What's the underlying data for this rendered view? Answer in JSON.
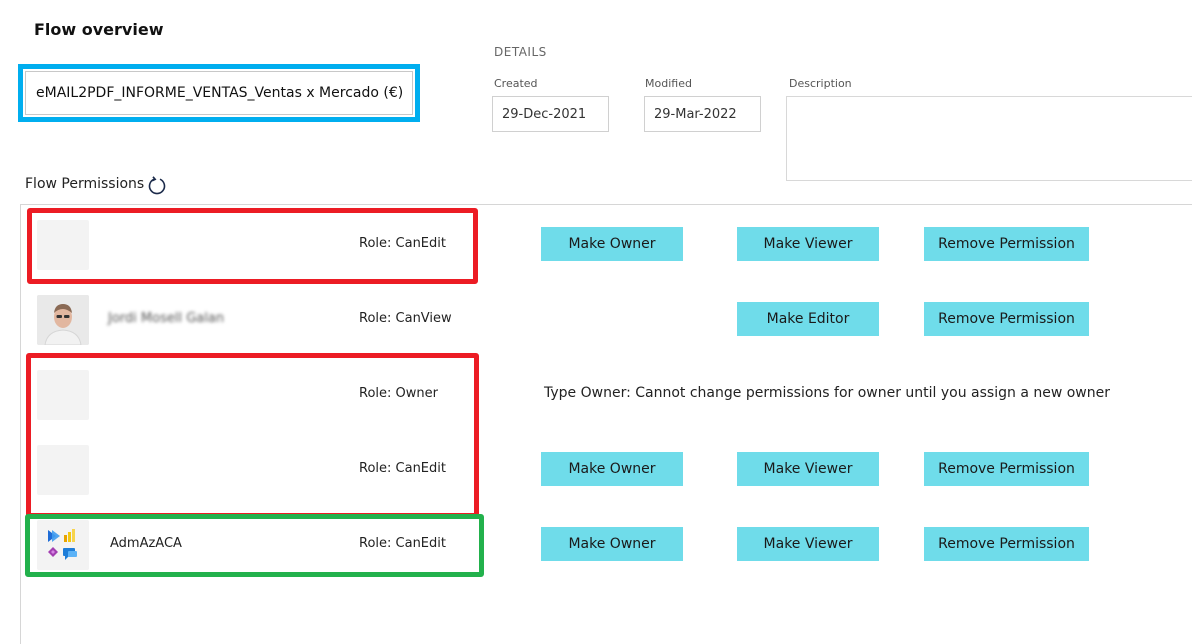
{
  "page": {
    "title": "Flow overview",
    "flow_name": "eMAIL2PDF_INFORME_VENTAS_Ventas x Mercado (€)"
  },
  "details": {
    "heading": "DETAILS",
    "created_label": "Created",
    "created_value": "29-Dec-2021",
    "modified_label": "Modified",
    "modified_value": "29-Mar-2022",
    "description_label": "Description",
    "description_value": ""
  },
  "permissions": {
    "label": "Flow Permissions",
    "refresh_icon": "refresh-icon",
    "rows": [
      {
        "user": "",
        "role": "Role: CanEdit",
        "buttons": [
          "Make Owner",
          "Make Viewer",
          "Remove Permission"
        ]
      },
      {
        "user": "Jordi Mosell Galan",
        "role": "Role: CanView",
        "buttons": [
          "Make Editor",
          "Remove Permission"
        ]
      },
      {
        "user": "",
        "role": "Role: Owner",
        "note": "Type Owner: Cannot change permissions for owner until you assign a new owner"
      },
      {
        "user": "",
        "role": "Role: CanEdit",
        "buttons": [
          "Make Owner",
          "Make Viewer",
          "Remove Permission"
        ]
      },
      {
        "user": "AdmAzACA",
        "role": "Role: CanEdit",
        "buttons": [
          "Make Owner",
          "Make Viewer",
          "Remove Permission"
        ]
      }
    ]
  },
  "colors": {
    "button_bg": "#6fdcea",
    "highlight_blue": "#00aeef",
    "highlight_red": "#ec1c24",
    "highlight_green": "#22b14c"
  }
}
